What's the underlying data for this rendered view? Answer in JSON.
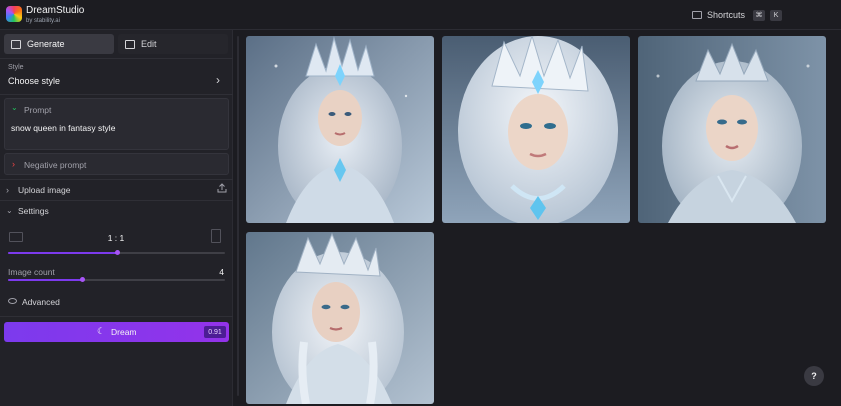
{
  "header": {
    "app_name": "DreamStudio",
    "app_sub": "by stability.ai",
    "shortcuts_label": "Shortcuts",
    "shortcut_keys": [
      "⌘",
      "K"
    ]
  },
  "sidebar": {
    "tabs": [
      {
        "label": "Generate",
        "icon": "grid-icon",
        "active": true
      },
      {
        "label": "Edit",
        "icon": "edit-icon",
        "active": false
      }
    ],
    "style": {
      "label": "Style",
      "value": "Choose style"
    },
    "prompt": {
      "label": "Prompt",
      "text": "snow queen in fantasy style"
    },
    "negative_prompt": {
      "label": "Negative prompt"
    },
    "upload": {
      "label": "Upload image"
    },
    "settings": {
      "label": "Settings",
      "aspect_ratio": "1 : 1",
      "aspect_slider_fraction": 0.5,
      "image_count_label": "Image count",
      "image_count": "4",
      "image_count_fraction": 0.34
    },
    "advanced": {
      "label": "Advanced"
    },
    "dream": {
      "label": "Dream",
      "credits": "0.91"
    }
  },
  "gallery": {
    "images": [
      {
        "name": "snow-queen-image-1",
        "description": "generated image"
      },
      {
        "name": "snow-queen-image-2",
        "description": "generated image"
      },
      {
        "name": "snow-queen-image-3",
        "description": "generated image"
      },
      {
        "name": "snow-queen-image-4",
        "description": "generated image"
      }
    ]
  },
  "help": {
    "label": "?"
  },
  "colors": {
    "accent": "#7c3aed",
    "background": "#1c1c21",
    "sidebar": "#222228"
  }
}
